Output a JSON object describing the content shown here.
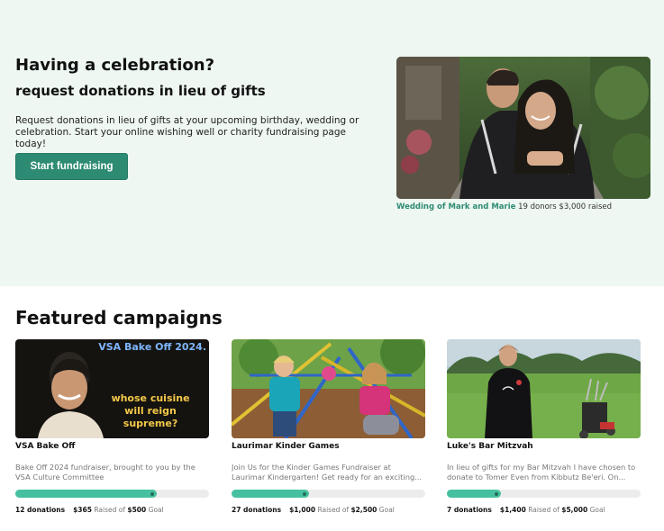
{
  "hero": {
    "title": "Having a celebration?",
    "subtitle": "request donations in lieu of gifts",
    "description": "Request donations in lieu of gifts at your upcoming birthday, wedding or celebration. Start your online wishing well or charity fundraising page today!",
    "cta_label": "Start fundraising",
    "caption_link": "Wedding of Mark and Marie",
    "caption_stats": "19 donors $3,000 raised"
  },
  "featured": {
    "title": "Featured campaigns",
    "campaigns": [
      {
        "name": "VSA Bake Off",
        "image_banner": "VSA Bake Off 2024.",
        "image_text": "whose cuisine will reign supreme?",
        "description": "Bake Off 2024 fundraiser, brought to you by the VSA Culture Committee",
        "progress": 0.73,
        "donations": "12 donations",
        "raised": "$365",
        "raised_of": "Raised of",
        "goal": "$500",
        "goal_label": "Goal"
      },
      {
        "name": "Laurimar Kinder Games",
        "description": "Join Us for the Kinder Games Fundraiser at Laurimar Kindergarten! Get ready for an exciting...",
        "progress": 0.4,
        "donations": "27 donations",
        "raised": "$1,000",
        "raised_of": "Raised of",
        "goal": "$2,500",
        "goal_label": "Goal"
      },
      {
        "name": "Luke's Bar Mitzvah",
        "description": "In lieu of gifts for my Bar Mitzvah I have chosen to donate to Tomer Even from Kibbutz Be'eri. On...",
        "progress": 0.28,
        "donations": "7 donations",
        "raised": "$1,400",
        "raised_of": "Raised of",
        "goal": "$5,000",
        "goal_label": "Goal"
      }
    ]
  },
  "colors": {
    "hero_bg": "#eef7f1",
    "accent": "#2e8b73",
    "progress_fill": "#46c1a0",
    "progress_track": "#ececec"
  }
}
